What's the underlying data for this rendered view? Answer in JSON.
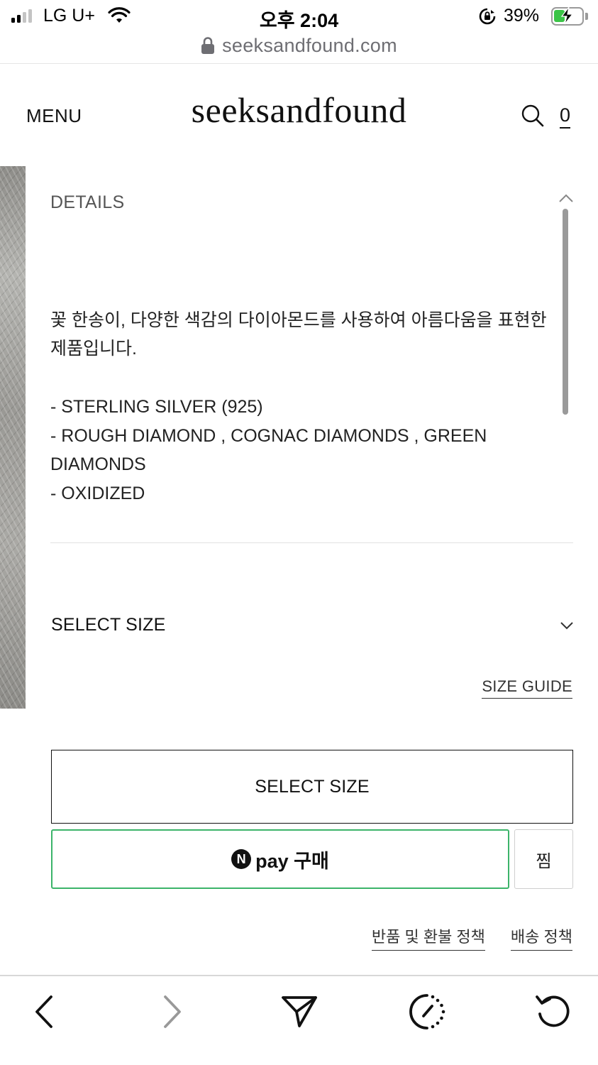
{
  "status_bar": {
    "carrier": "LG U+",
    "time": "오후 2:04",
    "battery_percent": "39%",
    "signal_bars_active": 2,
    "signal_bars_total": 4,
    "battery_level": 0.39,
    "charging": true,
    "icons": [
      "cellular-signal-icon",
      "wifi-icon",
      "rotation-lock-icon",
      "battery-charging-icon"
    ]
  },
  "browser": {
    "url": "seeksandfound.com",
    "secure": true
  },
  "header": {
    "menu_label": "MENU",
    "logo": "seeksandfound",
    "cart_count": "0"
  },
  "details": {
    "title": "DETAILS",
    "description": "꽃 한송이, 다양한 색감의 다이아몬드를 사용하여 아름다움을 표현한 제품입니다.",
    "items": [
      "- STERLING SILVER (925)",
      "- ROUGH DIAMOND , COGNAC DIAMONDS , GREEN DIAMONDS",
      "- OXIDIZED"
    ],
    "expanded": true
  },
  "size": {
    "label": "SELECT SIZE",
    "guide_link": "SIZE GUIDE"
  },
  "actions": {
    "select_size_button": "SELECT SIZE",
    "npay_logo": "N",
    "npay_label": "pay 구매",
    "wish_button": "찜"
  },
  "policies": {
    "return_policy": "반품 및 환불 정책",
    "shipping_policy": "배송 정책"
  },
  "toolbar": {
    "buttons": [
      "back-icon",
      "forward-icon",
      "share-icon",
      "timer-icon",
      "reload-icon"
    ]
  },
  "colors": {
    "npay_border": "#3cb46a",
    "battery_fill": "#3bc447",
    "text_primary": "#111111"
  }
}
